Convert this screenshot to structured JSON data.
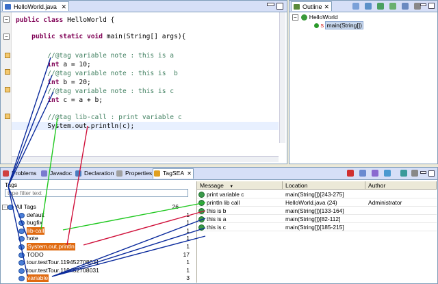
{
  "editor": {
    "tab_title": "HelloWorld.java",
    "code_lines": [
      {
        "parts": [
          {
            "t": "public class",
            "c": "kw"
          },
          {
            "t": " HelloWorld {",
            "c": ""
          }
        ]
      },
      {
        "parts": [
          {
            "t": "    public static void",
            "c": "kw"
          },
          {
            "t": " main(String[] args){",
            "c": ""
          }
        ]
      },
      {
        "parts": [
          {
            "t": "        //@tag variable note : this is a",
            "c": "cm"
          }
        ]
      },
      {
        "parts": [
          {
            "t": "        int",
            "c": "kw"
          },
          {
            "t": " a = 10;",
            "c": ""
          }
        ]
      },
      {
        "parts": [
          {
            "t": "        //@tag variable note : this is  b",
            "c": "cm"
          }
        ]
      },
      {
        "parts": [
          {
            "t": "        int",
            "c": "kw"
          },
          {
            "t": " b = 20;",
            "c": ""
          }
        ]
      },
      {
        "parts": [
          {
            "t": "        //@tag variable note : this is c",
            "c": "cm"
          }
        ]
      },
      {
        "parts": [
          {
            "t": "        int",
            "c": "kw"
          },
          {
            "t": " c = a + b;",
            "c": ""
          }
        ]
      },
      {
        "parts": [
          {
            "t": "        //@tag lib-call : print variable c",
            "c": "cm"
          }
        ]
      },
      {
        "parts": [
          {
            "t": "        System.out.println(c);",
            "c": ""
          }
        ]
      }
    ]
  },
  "outline": {
    "tab_title": "Outline",
    "class_node": "HelloWorld",
    "method_node": "main(String[])"
  },
  "bottom_tabs": [
    {
      "label": "Problems",
      "icon": "problems-icon"
    },
    {
      "label": "Javadoc",
      "icon": "javadoc-icon"
    },
    {
      "label": "Declaration",
      "icon": "declaration-icon"
    },
    {
      "label": "Properties",
      "icon": "properties-icon"
    },
    {
      "label": "TagSEA",
      "icon": "tagsea-icon"
    }
  ],
  "tags_panel": {
    "header": "Tags",
    "filter_placeholder": "type filter text",
    "items": [
      {
        "label": "All Tags",
        "count": "26",
        "level": 0,
        "highlight": false
      },
      {
        "label": "default",
        "count": "1",
        "level": 1,
        "highlight": false
      },
      {
        "label": "bugfix",
        "count": "1",
        "level": 1,
        "highlight": false
      },
      {
        "label": "lib-call",
        "count": "1",
        "level": 1,
        "highlight": true
      },
      {
        "label": "note",
        "count": "1",
        "level": 1,
        "highlight": false
      },
      {
        "label": "System.out.println",
        "count": "1",
        "level": 1,
        "highlight": true
      },
      {
        "label": "TODO",
        "count": "17",
        "level": 1,
        "highlight": false
      },
      {
        "label": "tour.testTour.119452708031",
        "count": "1",
        "level": 1,
        "highlight": false
      },
      {
        "label": "tour.testTour.119452708031",
        "count": "1",
        "level": 1,
        "highlight": false
      },
      {
        "label": "variable",
        "count": "3",
        "level": 1,
        "highlight": true
      }
    ]
  },
  "waypoints": {
    "columns": [
      "Message",
      "Location",
      "Author"
    ],
    "rows": [
      {
        "message": "print variable c",
        "location": "main(String[])[243-275]",
        "author": ""
      },
      {
        "message": "println lib call",
        "location": "HelloWorld.java (24)",
        "author": "Administrator"
      },
      {
        "message": "this is  b",
        "location": "main(String[])[133-164]",
        "author": ""
      },
      {
        "message": "this is a",
        "location": "main(String[])[82-112]",
        "author": ""
      },
      {
        "message": "this is c",
        "location": "main(String[])[185-215]",
        "author": ""
      }
    ]
  },
  "colors": {
    "keyword": "#7f0055",
    "comment": "#3f7f5f",
    "highlight": "#e06a10",
    "line_blue": "#0a2a9c",
    "line_green": "#1fc81f",
    "line_red": "#d0103a"
  }
}
